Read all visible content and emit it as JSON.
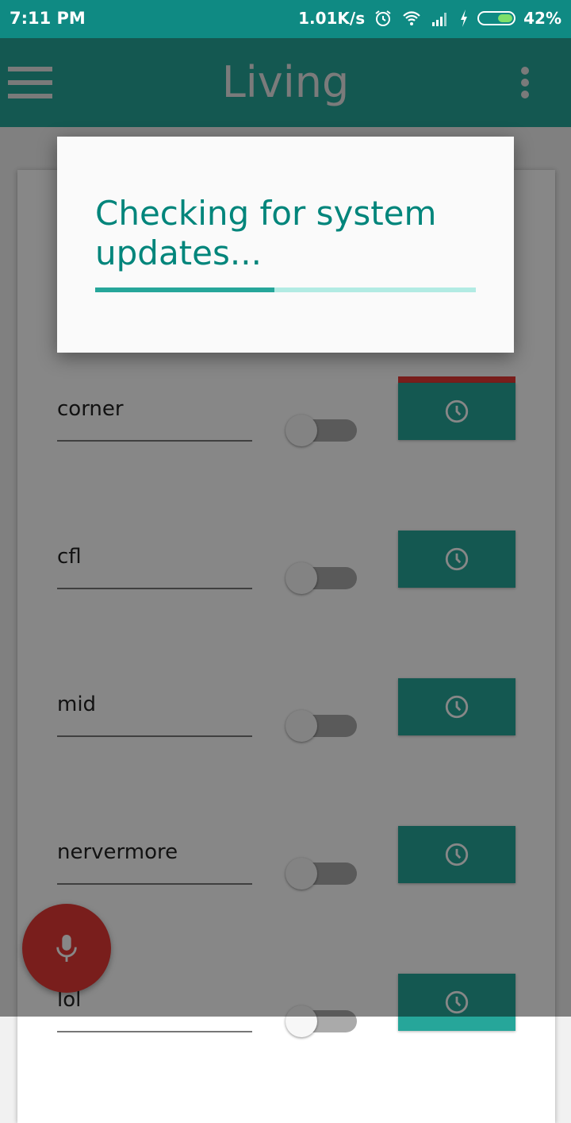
{
  "status_bar": {
    "time": "7:11 PM",
    "speed": "1.01K/s",
    "battery": "42%"
  },
  "app_bar": {
    "title": "Living"
  },
  "switches": [
    {
      "name": "corner",
      "on": false
    },
    {
      "name": "cfl",
      "on": false
    },
    {
      "name": "mid",
      "on": false
    },
    {
      "name": "nervermore",
      "on": false
    },
    {
      "name": "lol",
      "on": false
    }
  ],
  "dialog": {
    "message": "Checking for system updates...",
    "progress": 0.47
  },
  "colors": {
    "primary": "#26a69a",
    "status_bar": "#0f8a83",
    "accent": "#e53935",
    "dialog_text": "#00857b"
  },
  "icons": [
    "menu-icon",
    "more-vert-icon",
    "alarm-icon",
    "wifi-icon",
    "signal-icon",
    "charging-icon",
    "battery-icon",
    "clock-icon",
    "mic-icon"
  ]
}
